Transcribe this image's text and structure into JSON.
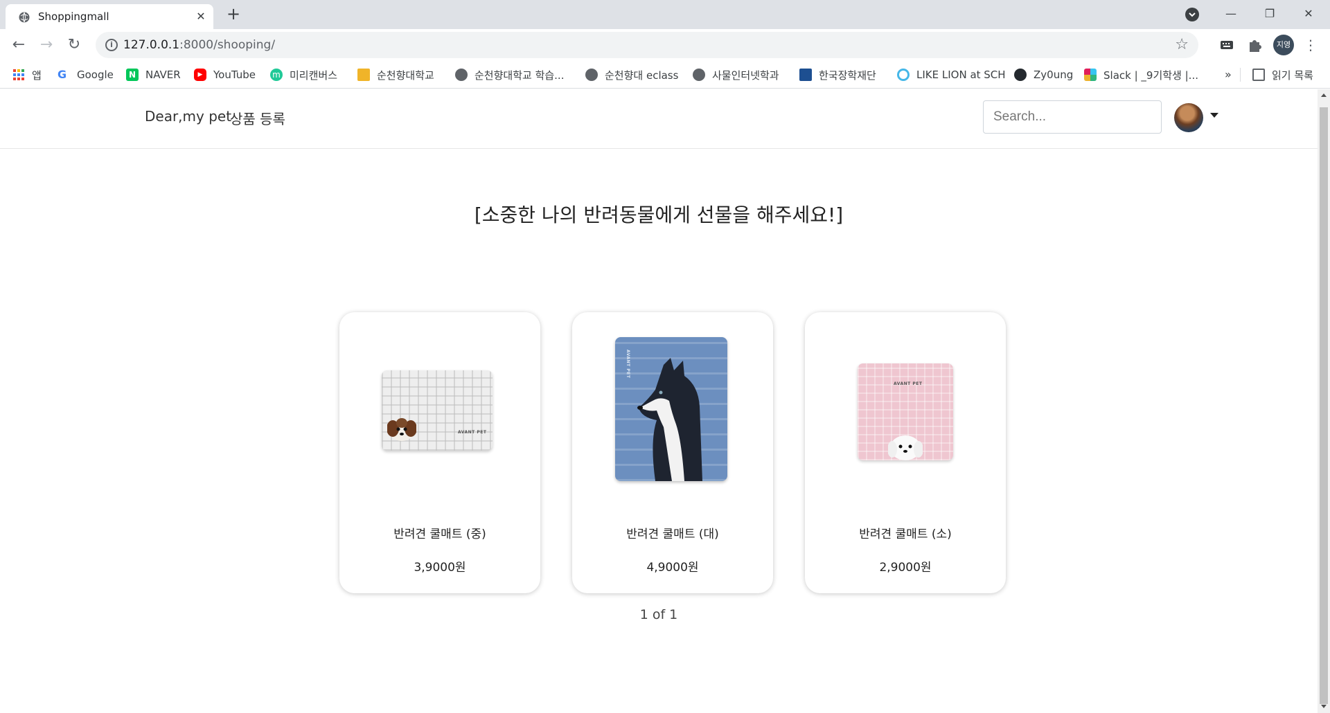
{
  "browser": {
    "tab_title": "Shoppingmall",
    "url_host": "127.0.0.1",
    "url_rest": ":8000/shooping/",
    "profile_initials": "지영"
  },
  "bookmarks": [
    {
      "label": "앱",
      "icon": "apps-grid-icon",
      "color": "#ea4335"
    },
    {
      "label": "Google",
      "icon": "google-icon",
      "color": "#4285f4"
    },
    {
      "label": "NAVER",
      "icon": "naver-icon",
      "color": "#03c75a"
    },
    {
      "label": "YouTube",
      "icon": "youtube-icon",
      "color": "#ff0000"
    },
    {
      "label": "미리캔버스",
      "icon": "miricanvas-icon",
      "color": "#20c997"
    },
    {
      "label": "순천향대학교",
      "icon": "sch-icon",
      "color": "#f0b429"
    },
    {
      "label": "순천향대학교 학습...",
      "icon": "globe-icon",
      "color": "#5f6368"
    },
    {
      "label": "순천향대 eclass",
      "icon": "globe-icon",
      "color": "#5f6368"
    },
    {
      "label": "사물인터넷학과",
      "icon": "globe-icon",
      "color": "#5f6368"
    },
    {
      "label": "한국장학재단",
      "icon": "graduation-icon",
      "color": "#1d4f91"
    },
    {
      "label": "LIKE LION at SCH",
      "icon": "likelion-icon",
      "color": "#45b7e8"
    },
    {
      "label": "Zy0ung",
      "icon": "github-icon",
      "color": "#24292e"
    },
    {
      "label": "Slack | _9기학생 |...",
      "icon": "slack-icon",
      "color": "#e01e5a"
    }
  ],
  "bookmarks_more": "»",
  "reading_list": "읽기 목록",
  "site": {
    "brand": "Dear,my pet",
    "nav_register": "상품 등록",
    "search_placeholder": "Search...",
    "heading": "[소중한 나의 반려동물에게 선물을 해주세요!]",
    "pager": "1 of 1"
  },
  "products": [
    {
      "name": "반려견 쿨매트 (중)",
      "price": "3,9000원"
    },
    {
      "name": "반려견 쿨매트 (대)",
      "price": "4,9000원"
    },
    {
      "name": "반려견 쿨매트 (소)",
      "price": "2,9000원"
    }
  ]
}
